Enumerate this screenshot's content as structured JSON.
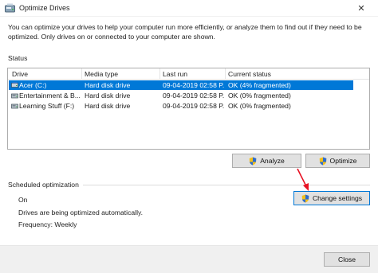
{
  "window": {
    "title": "Optimize Drives",
    "close_glyph": "✕"
  },
  "description": "You can optimize your drives to help your computer run more efficiently, or analyze them to find out if they need to be optimized. Only drives on or connected to your computer are shown.",
  "status": {
    "label": "Status",
    "columns": [
      "Drive",
      "Media type",
      "Last run",
      "Current status"
    ],
    "rows": [
      {
        "drive": "Acer (C:)",
        "media": "Hard disk drive",
        "last_run": "09-04-2019 02:58 P...",
        "status": "OK (4% fragmented)",
        "selected": true
      },
      {
        "drive": "Entertainment & B...",
        "media": "Hard disk drive",
        "last_run": "09-04-2019 02:58 P...",
        "status": "OK (0% fragmented)",
        "selected": false
      },
      {
        "drive": "Learning Stuff (F:)",
        "media": "Hard disk drive",
        "last_run": "09-04-2019 02:58 P...",
        "status": "OK (0% fragmented)",
        "selected": false
      }
    ]
  },
  "buttons": {
    "analyze": "Analyze",
    "optimize": "Optimize",
    "change_settings": "Change settings",
    "close": "Close"
  },
  "scheduled": {
    "label": "Scheduled optimization",
    "state": "On",
    "description": "Drives are being optimized automatically.",
    "frequency": "Frequency: Weekly"
  },
  "colors": {
    "selection": "#0078d7",
    "annotation_arrow": "#e81123",
    "button_bg": "#e1e1e1"
  },
  "icons": {
    "app": "optimize-drives-icon",
    "drive": "hard-drive-icon",
    "uac": "uac-shield-icon"
  }
}
